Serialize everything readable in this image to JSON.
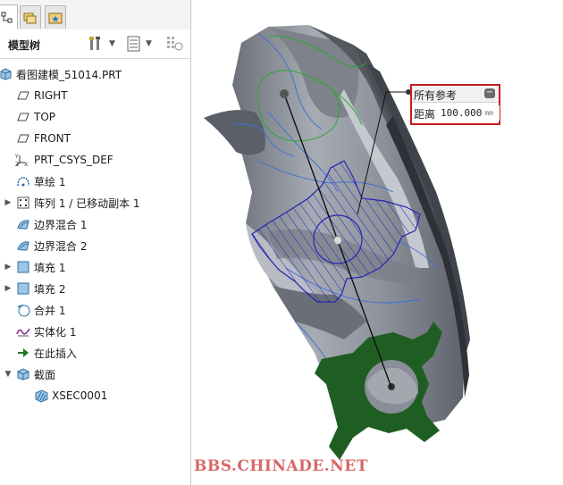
{
  "panel": {
    "title": "模型树"
  },
  "tree": {
    "root": "看图建模_51014.PRT",
    "items": [
      {
        "label": "RIGHT",
        "icon": "datum-plane-icon",
        "expandable": false
      },
      {
        "label": "TOP",
        "icon": "datum-plane-icon",
        "expandable": false
      },
      {
        "label": "FRONT",
        "icon": "datum-plane-icon",
        "expandable": false
      },
      {
        "label": "PRT_CSYS_DEF",
        "icon": "csys-icon",
        "expandable": false
      },
      {
        "label": "草绘 1",
        "icon": "sketch-icon",
        "expandable": false
      },
      {
        "label": "阵列 1 / 已移动副本 1",
        "icon": "pattern-icon",
        "expandable": true
      },
      {
        "label": "边界混合 1",
        "icon": "boundary-blend-icon",
        "expandable": false
      },
      {
        "label": "边界混合 2",
        "icon": "boundary-blend-icon",
        "expandable": false
      },
      {
        "label": "填充 1",
        "icon": "fill-icon",
        "expandable": true
      },
      {
        "label": "填充 2",
        "icon": "fill-icon",
        "expandable": true
      },
      {
        "label": "合并 1",
        "icon": "merge-icon",
        "expandable": false
      },
      {
        "label": "实体化 1",
        "icon": "solidify-icon",
        "expandable": false
      },
      {
        "label": "在此插入",
        "icon": "insert-here-arrow-icon",
        "expandable": false
      },
      {
        "label": "截面",
        "icon": "section-folder-icon",
        "expandable": true,
        "expanded": true
      },
      {
        "label": "XSEC0001",
        "icon": "xsection-icon",
        "expandable": false,
        "indent": 1
      }
    ]
  },
  "reference_box": {
    "title": "所有参考",
    "label": "距离",
    "value": "100.000",
    "unit": "mm"
  },
  "watermark": "BBS.CHINADE.NET",
  "colors": {
    "highlight_border": "#c81d1d",
    "section_green": "#1f5e22",
    "section_hatch": "#1a1ab0",
    "model_gray": "#8a8e98"
  }
}
